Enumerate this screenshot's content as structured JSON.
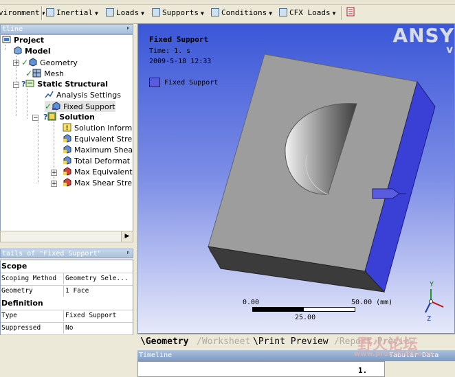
{
  "toolbar": {
    "items": [
      {
        "label": "vironment",
        "has_menu": true
      },
      {
        "label": "Inertial",
        "has_menu": true
      },
      {
        "label": "Loads",
        "has_menu": true
      },
      {
        "label": "Supports",
        "has_menu": true
      },
      {
        "label": "Conditions",
        "has_menu": true
      },
      {
        "label": "CFX Loads",
        "has_menu": true
      }
    ]
  },
  "outline": {
    "title": "tline",
    "pin": "ᵖ",
    "tree": [
      {
        "label": "Project",
        "bold": true
      },
      {
        "label": "Model",
        "bold": true
      },
      {
        "label": "Geometry"
      },
      {
        "label": "Mesh"
      },
      {
        "label": "Static Structural",
        "bold": true
      },
      {
        "label": "Analysis Settings"
      },
      {
        "label": "Fixed Support",
        "selected": true
      },
      {
        "label": "Solution",
        "bold": true
      },
      {
        "label": "Solution Inform"
      },
      {
        "label": "Equivalent Stre"
      },
      {
        "label": "Maximum Shear"
      },
      {
        "label": "Total Deformat"
      },
      {
        "label": "Max Equivalent"
      },
      {
        "label": "Max Shear Stre"
      }
    ]
  },
  "details": {
    "title": "tails of \"Fixed Support\"",
    "sections": [
      {
        "heading": "Scope",
        "rows": [
          {
            "key": "Scoping Method",
            "value": "Geometry Sele..."
          },
          {
            "key": "Geometry",
            "value": "1 Face"
          }
        ]
      },
      {
        "heading": "Definition",
        "rows": [
          {
            "key": "Type",
            "value": "Fixed Support"
          },
          {
            "key": "Suppressed",
            "value": "No"
          }
        ]
      }
    ]
  },
  "viewport": {
    "title": "Fixed Support",
    "time": "Time: 1. s",
    "date": "2009-5-18 12:33",
    "legend": "Fixed Support",
    "logo": "ANSY",
    "logo_sub": "v",
    "scale": {
      "left": "0.00",
      "right": "50.00 (mm)",
      "mid": "25.00"
    },
    "axes": {
      "y": "Y",
      "z": "Z"
    },
    "colors": {
      "support_face": "#3a3fd6",
      "body": "#9c9c9c"
    }
  },
  "bottom_tabs": [
    {
      "label": "Geometry",
      "active": true
    },
    {
      "label": "Worksheet",
      "active": false
    },
    {
      "label": "Print Preview",
      "active": false
    },
    {
      "label": "Report Preview",
      "active": false
    }
  ],
  "timeline": {
    "title": "Timeline",
    "marker": "1.",
    "tabular": "Tabular Data"
  },
  "watermark": {
    "line1": "野火论坛",
    "line2": "www.proewildfire.cn"
  }
}
